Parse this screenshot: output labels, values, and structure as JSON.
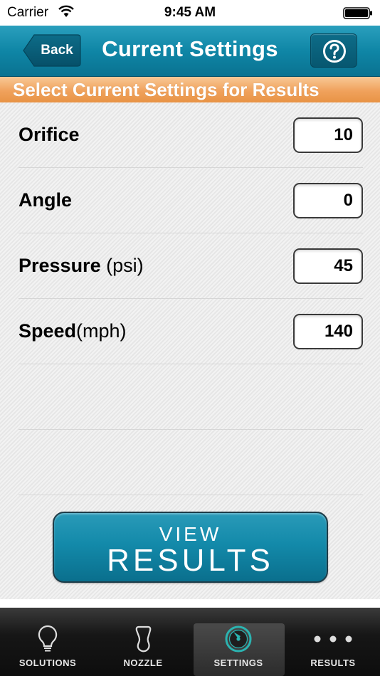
{
  "status_bar": {
    "carrier": "Carrier",
    "time": "9:45 AM"
  },
  "nav": {
    "back_label": "Back",
    "title": "Current Settings",
    "help_icon": "question-circle-icon"
  },
  "banner": {
    "text": "Select Current Settings for Results"
  },
  "settings": [
    {
      "label": "Orifice",
      "unit": "",
      "value": "10"
    },
    {
      "label": "Angle",
      "unit": "",
      "value": "0"
    },
    {
      "label": "Pressure",
      "unit": " (psi)",
      "value": "45"
    },
    {
      "label": "Speed",
      "unit": "(mph)",
      "value": "140"
    }
  ],
  "view_results": {
    "line1": "VIEW",
    "line2": "RESULTS"
  },
  "tabs": [
    {
      "label": "SOLUTIONS",
      "icon": "lightbulb-icon",
      "active": false
    },
    {
      "label": "NOZZLE",
      "icon": "nozzle-icon",
      "active": false
    },
    {
      "label": "SETTINGS",
      "icon": "gauge-icon",
      "active": true
    },
    {
      "label": "RESULTS",
      "icon": "more-dots-icon",
      "active": false
    }
  ],
  "colors": {
    "nav": "#0f86a6",
    "banner": "#f0a25c",
    "accent_teal": "#138aaa"
  }
}
